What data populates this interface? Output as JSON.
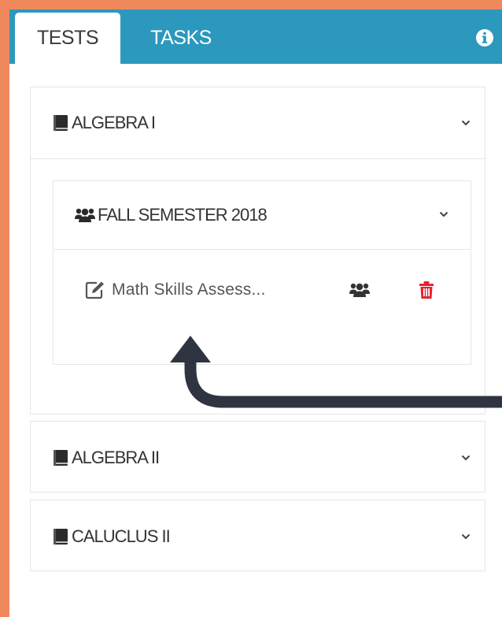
{
  "tabs": [
    {
      "label": "TESTS",
      "active": true
    },
    {
      "label": "TASKS",
      "active": false
    }
  ],
  "icons": {
    "info": "info-circle-icon",
    "course": "book-icon",
    "section": "users-icon",
    "assignment": "edit-icon",
    "assign": "users-icon",
    "delete": "trash-icon",
    "expand": "chevron-down-icon"
  },
  "courses": [
    {
      "name": "ALGEBRA I",
      "expanded": true
    },
    {
      "name": "ALGEBRA II",
      "expanded": false
    },
    {
      "name": "CALUCLUS II",
      "expanded": false
    }
  ],
  "section": {
    "name": "FALL SEMESTER 2018",
    "expanded": true
  },
  "assignment": {
    "name": "Math Skills Assess..."
  },
  "colors": {
    "background": "#f08a5d",
    "tabbar": "#2c98bd",
    "delete": "#e8232d",
    "arrow": "#2f3441"
  }
}
